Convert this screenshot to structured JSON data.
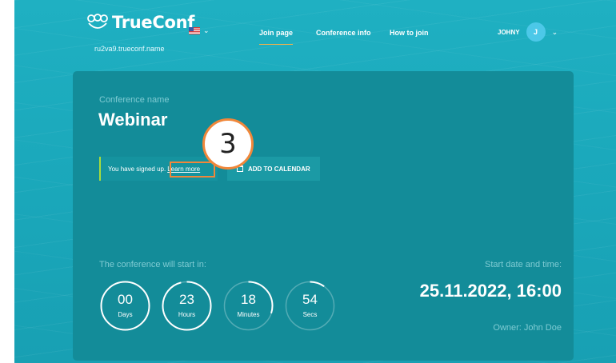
{
  "header": {
    "logo_text": "TrueConf",
    "server": "ru2va9.trueconf.name",
    "nav": [
      {
        "label": "Join page"
      },
      {
        "label": "Conference info"
      },
      {
        "label": "How to join"
      }
    ],
    "user": {
      "name": "JOHNY",
      "initial": "J"
    }
  },
  "conference": {
    "caption": "Conference name",
    "name": "Webinar",
    "signed_text": "You have signed up.",
    "learn_more": "Learn more",
    "calendar_button": "ADD TO CALENDAR",
    "step_marker": "3"
  },
  "countdown": {
    "caption": "The conference will start in:",
    "timers": [
      {
        "value": "00",
        "label": "Days",
        "fraction": 1.0
      },
      {
        "value": "23",
        "label": "Hours",
        "fraction": 0.96
      },
      {
        "value": "18",
        "label": "Minutes",
        "fraction": 0.3
      },
      {
        "value": "54",
        "label": "Secs",
        "fraction": 0.1
      }
    ]
  },
  "schedule": {
    "caption": "Start date and time:",
    "value": "25.11.2022, 16:00",
    "owner": "Owner: John Doe"
  },
  "colors": {
    "background": "#1aa7ba",
    "panel": "#138c99",
    "accent_orange": "#f0873a",
    "signed_bar": "#a8dc3c",
    "avatar": "#4cc8e8"
  },
  "icons": [
    "trueconf-logo-icon",
    "us-flag-icon",
    "chevron-down-icon",
    "calendar-icon"
  ]
}
